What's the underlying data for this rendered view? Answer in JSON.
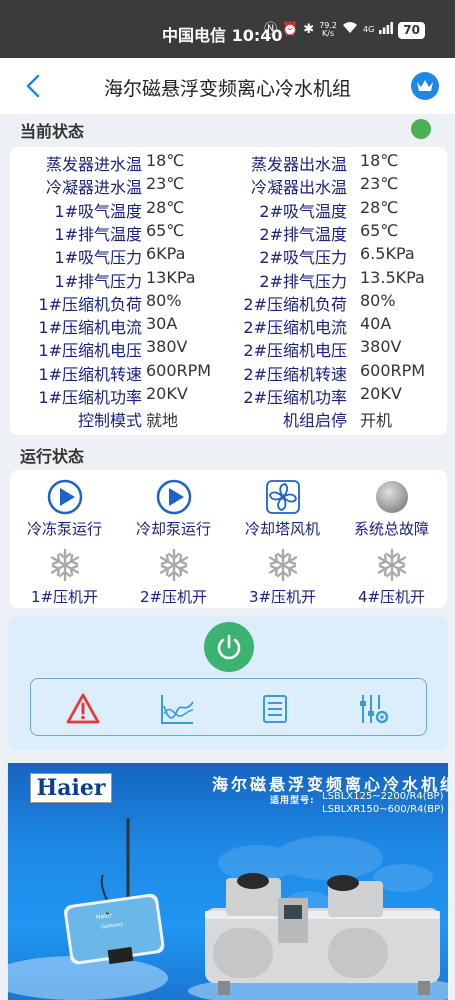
{
  "status_bar": {
    "carrier_time": "中国电信 10:40",
    "speed_value": "79.2",
    "speed_unit": "K/s",
    "network": "4G",
    "battery": "70"
  },
  "header": {
    "title": "海尔磁悬浮变频离心冷水机组",
    "back_icon": "chevron-left-icon",
    "crown_icon": "crown-icon"
  },
  "current_status": {
    "label": "当前状态",
    "indicator_color": "#4caf50",
    "rows": [
      {
        "l1": "蒸发器进水温",
        "v1": "18℃",
        "l2": "蒸发器出水温",
        "v2": "18℃"
      },
      {
        "l1": "冷凝器进水温",
        "v1": "23℃",
        "l2": "冷凝器出水温",
        "v2": "23℃"
      },
      {
        "l1": "1#吸气温度",
        "v1": "28℃",
        "l2": "2#吸气温度",
        "v2": "28℃"
      },
      {
        "l1": "1#排气温度",
        "v1": "65℃",
        "l2": "2#排气温度",
        "v2": "65℃"
      },
      {
        "l1": "1#吸气压力",
        "v1": "6KPa",
        "l2": "2#吸气压力",
        "v2": "6.5KPa"
      },
      {
        "l1": "1#排气压力",
        "v1": "13KPa",
        "l2": "2#排气压力",
        "v2": "13.5KPa"
      },
      {
        "l1": "1#压缩机负荷",
        "v1": "80%",
        "l2": "2#压缩机负荷",
        "v2": "80%"
      },
      {
        "l1": "1#压缩机电流",
        "v1": "30A",
        "l2": "2#压缩机电流",
        "v2": "40A"
      },
      {
        "l1": "1#压缩机电压",
        "v1": "380V",
        "l2": "2#压缩机电压",
        "v2": "380V"
      },
      {
        "l1": "1#压缩机转速",
        "v1": "600RPM",
        "l2": "2#压缩机转速",
        "v2": "600RPM"
      },
      {
        "l1": "1#压缩机功率",
        "v1": "20KV",
        "l2": "2#压缩机功率",
        "v2": "20KV"
      },
      {
        "l1": "控制模式",
        "v1": "就地",
        "l2": "机组启停",
        "v2": "开机"
      }
    ]
  },
  "running_status": {
    "label": "运行状态",
    "items": [
      {
        "label": "冷冻泵运行",
        "icon": "play-icon"
      },
      {
        "label": "冷却泵运行",
        "icon": "play-icon"
      },
      {
        "label": "冷却塔风机",
        "icon": "fan-icon"
      },
      {
        "label": "系统总故障",
        "icon": "fault-indicator-icon"
      },
      {
        "label": "1#压机开",
        "icon": "snowflake-icon"
      },
      {
        "label": "2#压机开",
        "icon": "snowflake-icon"
      },
      {
        "label": "3#压机开",
        "icon": "snowflake-icon"
      },
      {
        "label": "4#压机开",
        "icon": "snowflake-icon"
      }
    ]
  },
  "controls": {
    "power_icon": "power-icon",
    "power_color": "#3cb371",
    "tools": [
      "warning-icon",
      "trend-chart-icon",
      "list-icon",
      "settings-sliders-icon"
    ]
  },
  "banner": {
    "logo": "Haier",
    "title": "海尔磁悬浮变频离心冷水机组",
    "model_label": "适用型号:",
    "model_1": "LSBLX125~2200/R4(BP)",
    "model_2": "LSBLXR150~600/R4(BP)",
    "gateway_brand": "Haier",
    "gateway_label": "Gateway"
  },
  "colors": {
    "label_text": "#1a237e",
    "accent_blue": "#1e88e5",
    "panel_bg": "#dceefb"
  }
}
